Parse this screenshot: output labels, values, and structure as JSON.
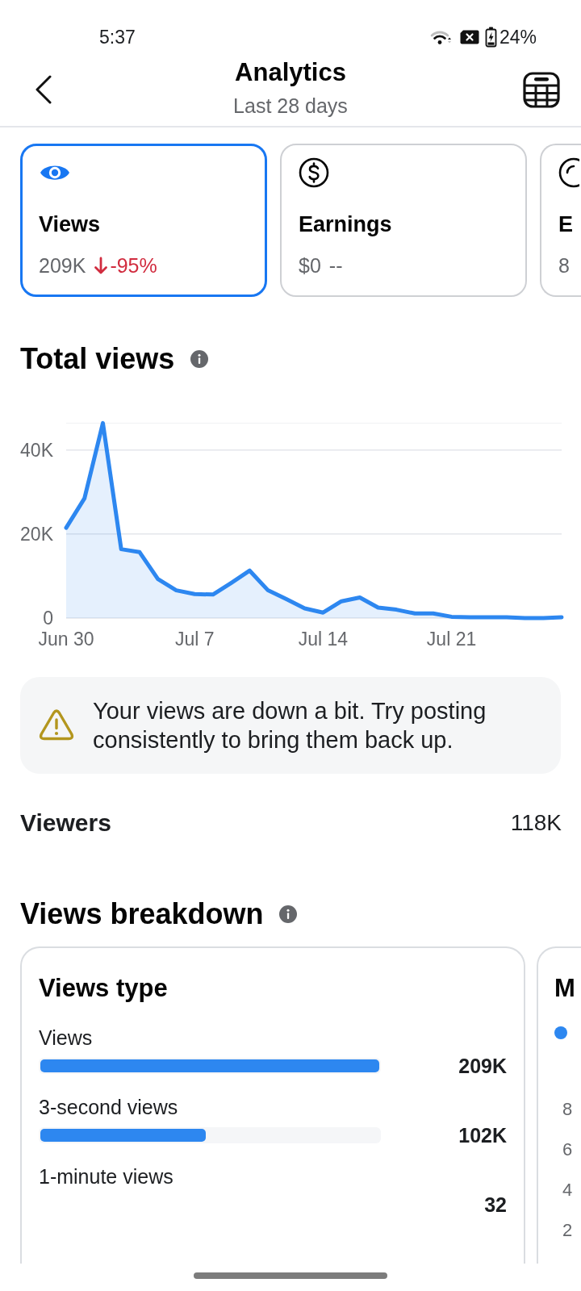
{
  "status_bar": {
    "time": "5:37",
    "battery": "24%"
  },
  "header": {
    "title": "Analytics",
    "subtitle": "Last 28 days"
  },
  "metric_cards": [
    {
      "kind": "views",
      "label": "Views",
      "value": "209K",
      "change": "-95%",
      "down": true,
      "selected": true
    },
    {
      "kind": "earnings",
      "label": "Earnings",
      "value": "$0",
      "change": "--",
      "down": false,
      "selected": false
    },
    {
      "kind": "other",
      "label": "E",
      "value": "8",
      "selected": false
    }
  ],
  "total_views": {
    "title": "Total views",
    "chart_data": {
      "type": "area",
      "categories": [
        "Jun 30",
        null,
        null,
        null,
        null,
        null,
        null,
        "Jul 7",
        null,
        null,
        null,
        null,
        null,
        null,
        "Jul 14",
        null,
        null,
        null,
        null,
        null,
        null,
        "Jul 21",
        null,
        null,
        null,
        null,
        null,
        null
      ],
      "ylim": [
        0,
        46400
      ],
      "series": [
        {
          "color": "#2d87f0",
          "values": [
            21500,
            28500,
            46400,
            16400,
            15700,
            9300,
            6600,
            5700,
            5600,
            8400,
            11300,
            6600,
            4500,
            2300,
            1300,
            4000,
            4900,
            2500,
            2000,
            1100,
            1100,
            300,
            200,
            200,
            200,
            0,
            0,
            200
          ]
        }
      ],
      "yticks": [
        {
          "value": 0,
          "label": "0"
        },
        {
          "value": 20000,
          "label": "20K"
        },
        {
          "value": 40000,
          "label": "40K"
        }
      ]
    }
  },
  "notice": {
    "kind": "warning",
    "text": "Your views are down a bit. Try posting consistently to bring them back up."
  },
  "stats": [
    {
      "label": "Viewers",
      "value": "118K"
    }
  ],
  "views_breakdown": {
    "title": "Views breakdown",
    "cards": [
      {
        "kind": "bars",
        "title": "Views type",
        "rows": [
          {
            "label": "Views",
            "value": "209K",
            "level": 1
          },
          {
            "label": "3-second views",
            "value": "102K",
            "level": 0.488
          },
          {
            "label": "1-minute views",
            "value": "32"
          }
        ]
      },
      {
        "kind": "chart",
        "title": "M",
        "axis_labels": [
          "8",
          "6",
          "4",
          "2"
        ]
      }
    ]
  }
}
